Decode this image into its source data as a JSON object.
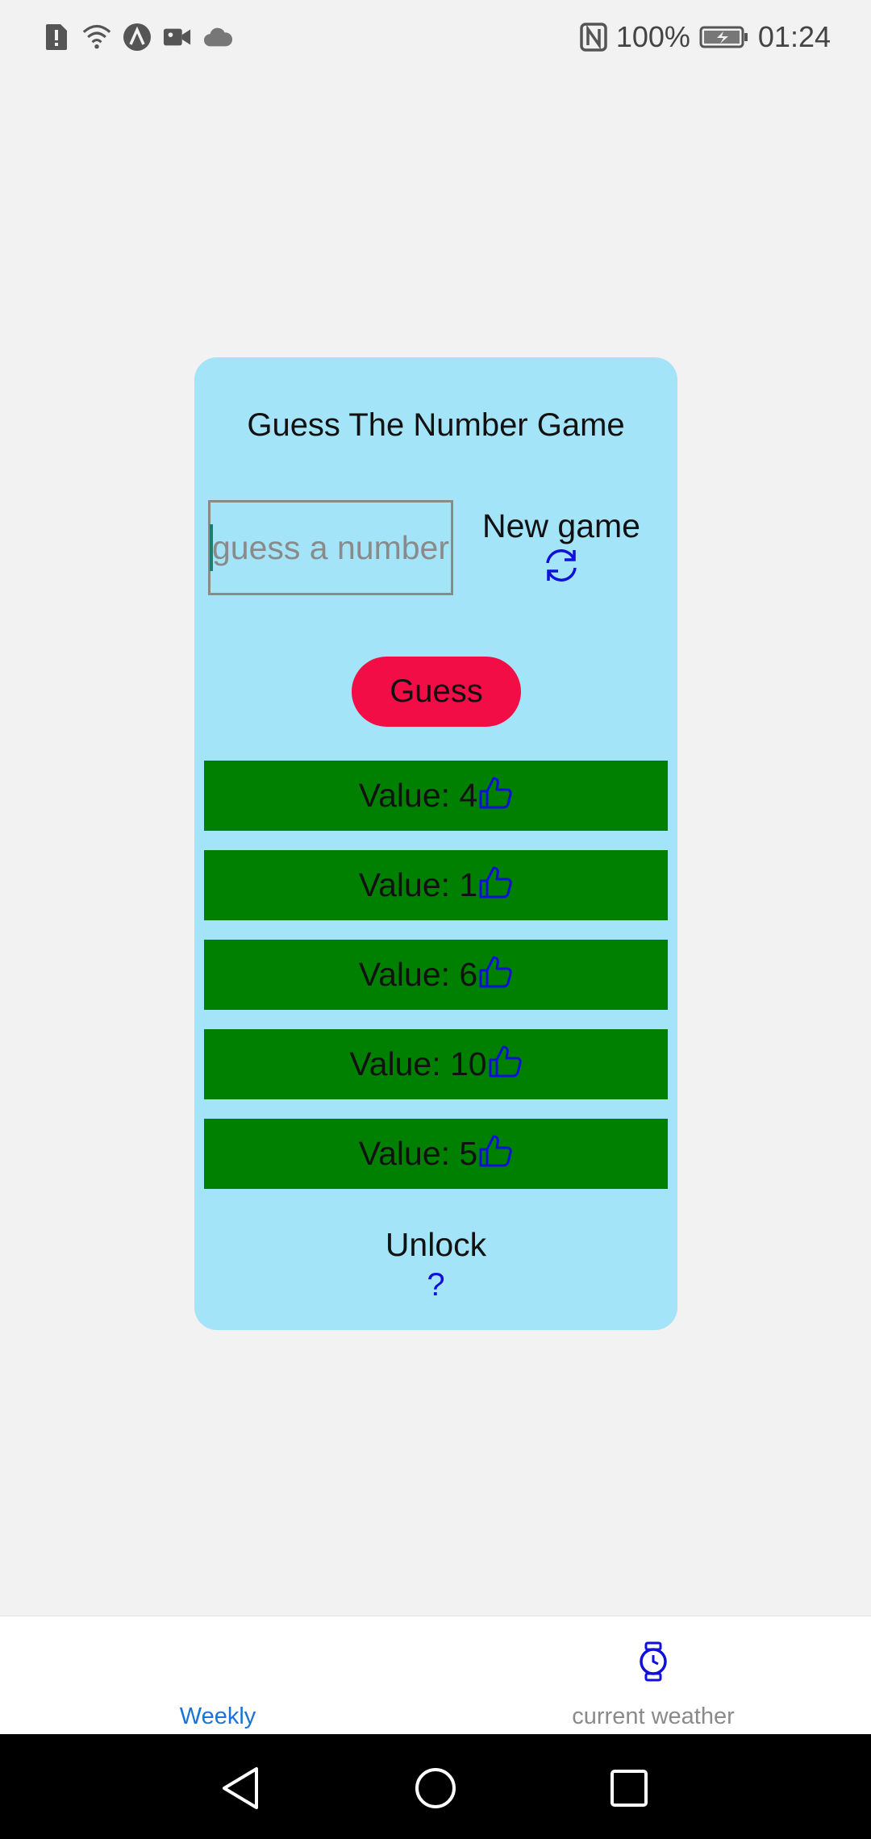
{
  "status_bar": {
    "battery": "100%",
    "time": "01:24"
  },
  "game": {
    "title": "Guess The Number Game",
    "input_placeholder": "guess a number",
    "input_value": "",
    "new_game_label": "New game",
    "guess_label": "Guess",
    "values": [
      {
        "text": "Value: 4"
      },
      {
        "text": "Value: 1"
      },
      {
        "text": "Value: 6"
      },
      {
        "text": "Value: 10"
      },
      {
        "text": "Value: 5"
      }
    ],
    "unlock_label": "Unlock",
    "unlock_icon": "?"
  },
  "tabs": [
    {
      "label": "Weekly",
      "active": true
    },
    {
      "label": "current weather",
      "active": false
    }
  ],
  "colors": {
    "card": "#a3e4f8",
    "guess_button": "#f20d47",
    "value_row": "#008000",
    "icon_blue": "#1010d8",
    "tab_active": "#1a73d9"
  }
}
